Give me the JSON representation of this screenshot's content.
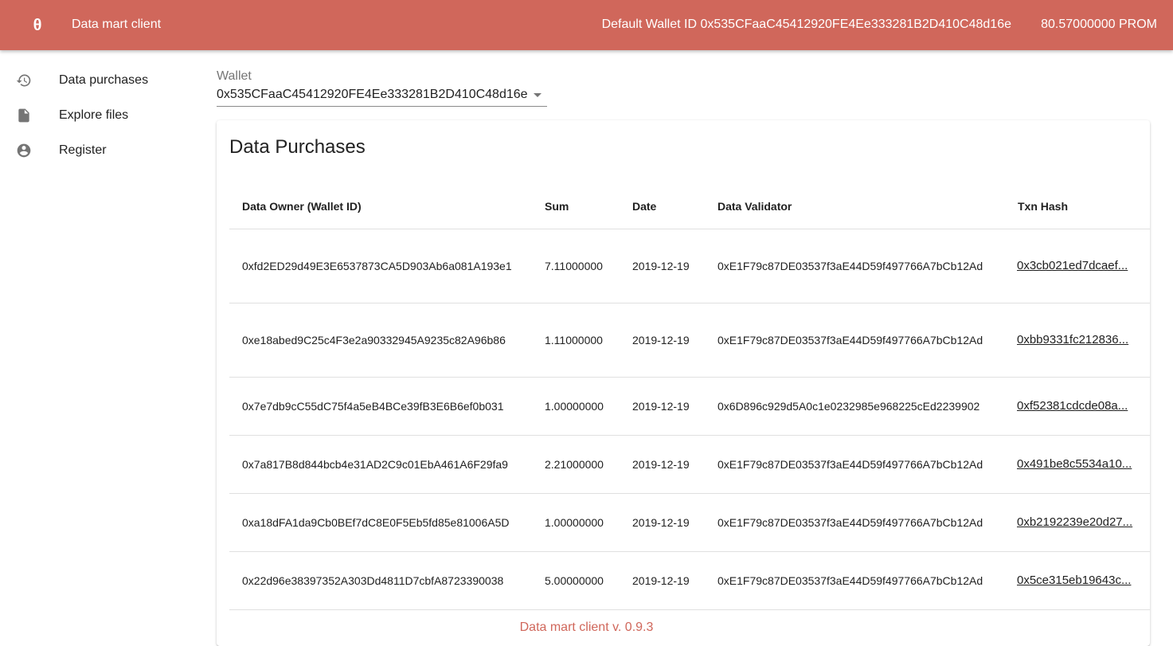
{
  "header": {
    "logo_icon": "theta-logo-icon",
    "logo_glyph": "θ",
    "app_title": "Data mart client",
    "wallet_label": "Default Wallet ID 0x535CFaaC45412920FE4Ee333281B2D410C48d16e",
    "balance": "80.57000000 PROM",
    "bar_color": "#d0675b"
  },
  "sidebar": {
    "items": [
      {
        "label": "Data purchases",
        "icon": "history-icon"
      },
      {
        "label": "Explore files",
        "icon": "file-icon"
      },
      {
        "label": "Register",
        "icon": "account-circle-icon"
      }
    ]
  },
  "wallet_select": {
    "label": "Wallet",
    "value": "0x535CFaaC45412920FE4Ee333281B2D410C48d16e"
  },
  "purchases": {
    "title": "Data Purchases",
    "columns": [
      "Data Owner (Wallet ID)",
      "Sum",
      "Date",
      "Data Validator",
      "Txn Hash"
    ],
    "rows": [
      {
        "owner": "0xfd2ED29d49E3E6537873CA5D903Ab6a081A193e1",
        "sum": "7.11000000",
        "date": "2019-12-19",
        "validator": "0xE1F79c87DE03537f3aE44D59f497766A7bCb12Ad",
        "hash": "0x3cb021ed7dcaef..."
      },
      {
        "owner": "0xe18abed9C25c4F3e2a90332945A9235c82A96b86",
        "sum": "1.11000000",
        "date": "2019-12-19",
        "validator": "0xE1F79c87DE03537f3aE44D59f497766A7bCb12Ad",
        "hash": "0xbb9331fc212836..."
      },
      {
        "owner": "0x7e7db9cC55dC75f4a5eB4BCe39fB3E6B6ef0b031",
        "sum": "1.00000000",
        "date": "2019-12-19",
        "validator": "0x6D896c929d5A0c1e0232985e968225cEd2239902",
        "hash": "0xf52381cdcde08a..."
      },
      {
        "owner": "0x7a817B8d844bcb4e31AD2C9c01EbA461A6F29fa9",
        "sum": "2.21000000",
        "date": "2019-12-19",
        "validator": "0xE1F79c87DE03537f3aE44D59f497766A7bCb12Ad",
        "hash": "0x491be8c5534a10..."
      },
      {
        "owner": "0xa18dFA1da9Cb0BEf7dC8E0F5Eb5fd85e81006A5D",
        "sum": "1.00000000",
        "date": "2019-12-19",
        "validator": "0xE1F79c87DE03537f3aE44D59f497766A7bCb12Ad",
        "hash": "0xb2192239e20d27..."
      },
      {
        "owner": "0x22d96e38397352A303Dd4811D7cbfA8723390038",
        "sum": "5.00000000",
        "date": "2019-12-19",
        "validator": "0xE1F79c87DE03537f3aE44D59f497766A7bCb12Ad",
        "hash": "0x5ce315eb19643c..."
      }
    ]
  },
  "footer": {
    "text": "Data mart client v. 0.9.3"
  }
}
